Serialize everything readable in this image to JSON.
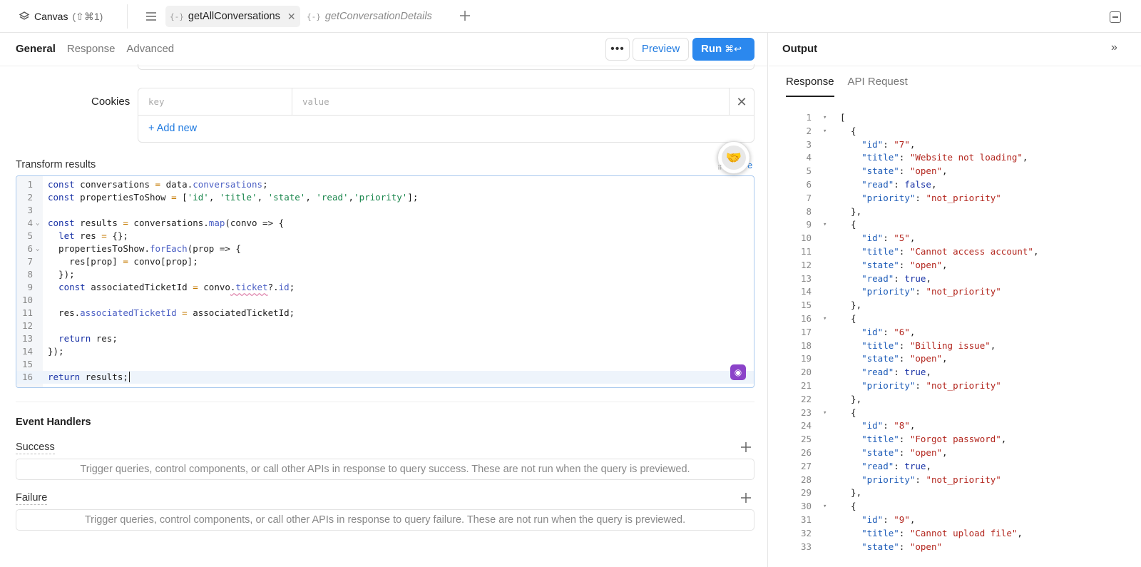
{
  "topbar": {
    "canvas_label": "Canvas",
    "canvas_shortcut": "(⇧⌘1)",
    "tabs": [
      {
        "label": "getAllConversations",
        "active": true
      },
      {
        "label": "getConversationDetails",
        "active": false
      }
    ]
  },
  "editor_panel": {
    "subtabs": [
      "General",
      "Response",
      "Advanced"
    ],
    "more_label": "•••",
    "preview_label": "Preview",
    "run_label": "Run",
    "run_shortcut": "⌘↩",
    "cookies": {
      "label": "Cookies",
      "key_placeholder": "key",
      "value_placeholder": "value",
      "add_new": "+ Add new"
    },
    "transform": {
      "label": "Transform results",
      "link_fragment": "e",
      "lines": [
        "const conversations = data.conversations;",
        "const propertiesToShow = ['id', 'title', 'state', 'read','priority'];",
        "",
        "const results = conversations.map(convo => {",
        "  let res = {};",
        "  propertiesToShow.forEach(prop => {",
        "    res[prop] = convo[prop];",
        "  });",
        "  const associatedTicketId = convo.ticket?.id;",
        "",
        "  res.associatedTicketId = associatedTicketId;",
        "",
        "  return res;",
        "});",
        "",
        "return results;"
      ]
    },
    "event_handlers": {
      "title": "Event Handlers",
      "success_label": "Success",
      "success_text": "Trigger queries, control components, or call other APIs in response to query success. These are not run when the query is previewed.",
      "failure_label": "Failure",
      "failure_text": "Trigger queries, control components, or call other APIs in response to query failure. These are not run when the query is previewed."
    }
  },
  "output": {
    "title": "Output",
    "tabs": [
      "Response",
      "API Request"
    ],
    "items": [
      {
        "id": "7",
        "title": "Website not loading",
        "state": "open",
        "read": "false",
        "priority": "not_priority"
      },
      {
        "id": "5",
        "title": "Cannot access account",
        "state": "open",
        "read": "true",
        "priority": "not_priority"
      },
      {
        "id": "6",
        "title": "Billing issue",
        "state": "open",
        "read": "true",
        "priority": "not_priority"
      },
      {
        "id": "8",
        "title": "Forgot password",
        "state": "open",
        "read": "true",
        "priority": "not_priority"
      },
      {
        "id": "9",
        "title": "Cannot upload file",
        "state": "open"
      }
    ]
  },
  "colors": {
    "accent": "#2b88ee",
    "ai": "#8b43c9"
  }
}
